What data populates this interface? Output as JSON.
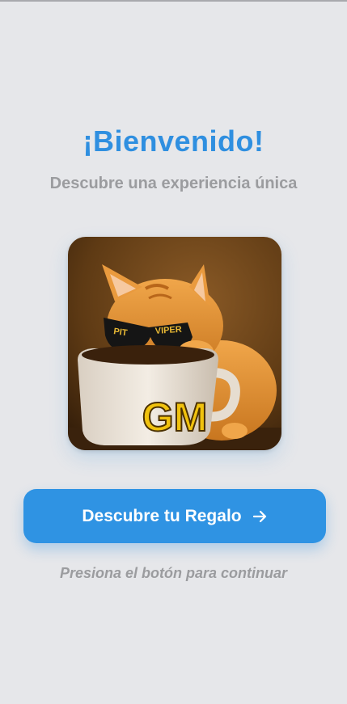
{
  "header": {
    "title": "¡Bienvenido!",
    "subtitle": "Descubre una experiencia única"
  },
  "hero_image": {
    "description_icon": "kitten-with-sunglasses-coffee-cup",
    "sunglasses_text": [
      "PIT",
      "VIPER"
    ],
    "mug_text": "GM"
  },
  "cta": {
    "label": "Descubre tu Regalo",
    "icon": "arrow-right-icon"
  },
  "hint": "Presiona el botón para continuar",
  "colors": {
    "accent": "#2f8fe0",
    "button": "#2f93e3",
    "background": "#e6e7ea",
    "muted_text": "#9b9c9f"
  }
}
